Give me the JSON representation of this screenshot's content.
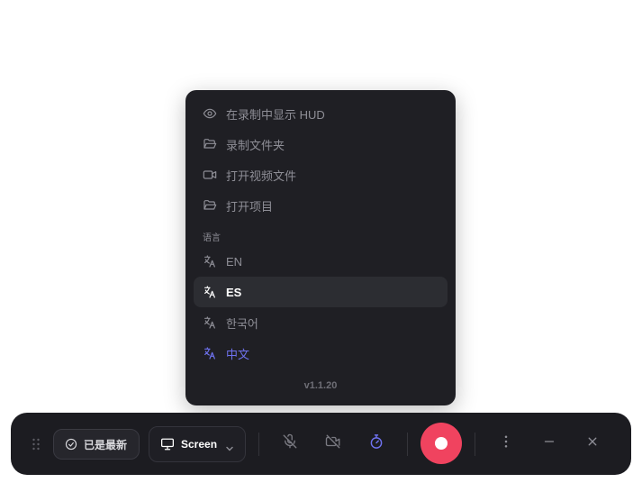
{
  "menu": {
    "items": [
      {
        "label": "在录制中显示 HUD",
        "icon": "eye-icon"
      },
      {
        "label": "录制文件夹",
        "icon": "folder-open-icon"
      },
      {
        "label": "打开视频文件",
        "icon": "video-icon"
      },
      {
        "label": "打开项目",
        "icon": "folder-open-icon"
      }
    ],
    "section_label": "语言",
    "languages": [
      {
        "label": "EN",
        "state": "normal"
      },
      {
        "label": "ES",
        "state": "hover"
      },
      {
        "label": "한국어",
        "state": "normal"
      },
      {
        "label": "中文",
        "state": "selected"
      }
    ],
    "version": "v1.1.20"
  },
  "toolbar": {
    "status_label": "已是最新",
    "source_label": "Screen",
    "buttons": [
      "mic-off-icon",
      "camera-off-icon",
      "timer-icon",
      "record-button",
      "more-icon",
      "minimize-icon",
      "close-icon"
    ]
  },
  "colors": {
    "accent": "#6f72f0",
    "record": "#f0435f",
    "panel": "#1f1f24",
    "toolbar": "#1c1c21"
  }
}
